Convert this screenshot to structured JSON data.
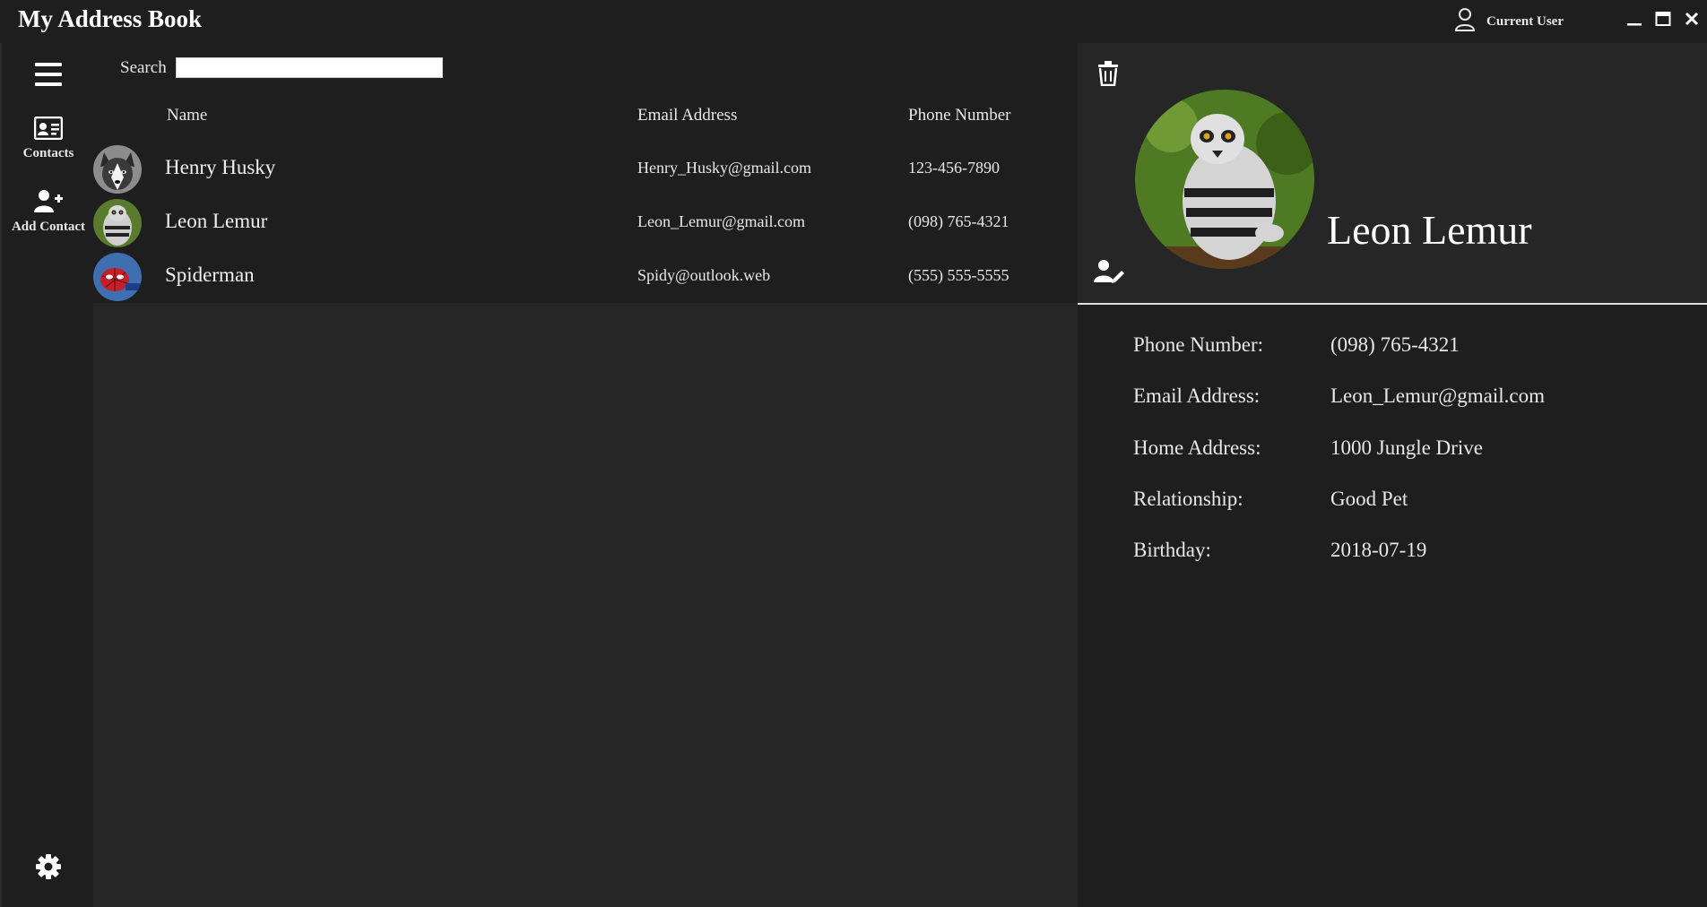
{
  "app": {
    "title": "My Address Book"
  },
  "user": {
    "label": "Current User"
  },
  "sidebar": {
    "items": [
      {
        "label": ""
      },
      {
        "label": "Contacts"
      },
      {
        "label": "Add Contact"
      }
    ]
  },
  "search": {
    "label": "Search",
    "value": ""
  },
  "table": {
    "headers": {
      "name": "Name",
      "email": "Email Address",
      "phone": "Phone Number"
    },
    "rows": [
      {
        "name": "Henry Husky",
        "email": "Henry_Husky@gmail.com",
        "phone": "123-456-7890",
        "avatar_icon": "husky-photo"
      },
      {
        "name": "Leon Lemur",
        "email": "Leon_Lemur@gmail.com",
        "phone": "(098) 765-4321",
        "avatar_icon": "lemur-photo"
      },
      {
        "name": "Spiderman",
        "email": "Spidy@outlook.web",
        "phone": "(555) 555-5555",
        "avatar_icon": "spiderman-photo"
      }
    ]
  },
  "detail": {
    "name": "Leon Lemur",
    "fields": [
      {
        "label": "Phone Number:",
        "value": "(098) 765-4321"
      },
      {
        "label": "Email Address:",
        "value": "Leon_Lemur@gmail.com"
      },
      {
        "label": "Home Address:",
        "value": "1000 Jungle Drive"
      },
      {
        "label": "Relationship:",
        "value": "Good Pet"
      },
      {
        "label": "Birthday:",
        "value": "2018-07-19"
      }
    ]
  },
  "icons": {
    "menu": "hamburger-icon",
    "contacts": "contact-card-icon",
    "add_contact": "user-plus-icon",
    "settings": "gear-icon",
    "user": "user-outline-icon",
    "delete": "trash-icon",
    "edit": "user-edit-icon"
  },
  "colors": {
    "background": "#1e1e1e",
    "panel": "#262626",
    "text": "#e8e8e8",
    "search_bg": "#ffffff"
  }
}
